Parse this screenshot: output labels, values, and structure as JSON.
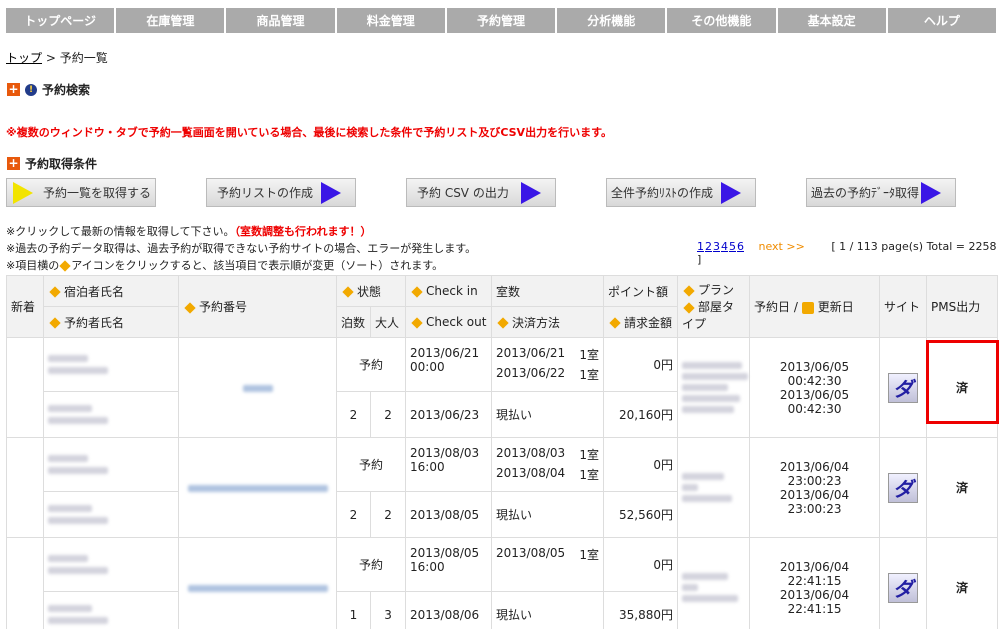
{
  "nav": [
    "トップページ",
    "在庫管理",
    "商品管理",
    "料金管理",
    "予約管理",
    "分析機能",
    "その他機能",
    "基本設定",
    "ヘルプ"
  ],
  "breadcrumb": {
    "home": "トップ",
    "sep": " > ",
    "current": "予約一覧"
  },
  "search_title": "予約検索",
  "warning": "※複数のウィンドウ・タブで予約一覧画面を開いている場合、最後に検索した条件で予約リスト及びCSV出力を行います。",
  "conditions_title": "予約取得条件",
  "buttons": [
    "予約一覧を取得する",
    "予約リストの作成",
    "予約 CSV の出力",
    "全件予約ﾘｽﾄの作成",
    "過去の予約ﾃﾞｰﾀ取得"
  ],
  "notes": {
    "line1": "※クリックして最新の情報を取得して下さい。",
    "line1_red": "（室数調整も行われます！）",
    "line2": "※過去の予約データ取得は、過去予約が取得できない予約サイトの場合、エラーが発生します。",
    "line3a": "※項目横の",
    "line3b": "アイコンをクリックすると、該当項目で表示順が変更（ソート）されます。"
  },
  "pager": {
    "pages": [
      "1",
      "2",
      "3",
      "4",
      "5",
      "6"
    ],
    "next": "next >>",
    "total": "[ 1 / 113 page(s) Total = 2258 ]"
  },
  "headers": {
    "new": "新着",
    "guest": "宿泊者氏名",
    "booker": "予約者氏名",
    "res_no": "予約番号",
    "status": "状態",
    "checkin": "Check in",
    "rooms": "室数",
    "points": "ポイント額",
    "plan": "プラン",
    "roomtype": "部屋タイプ",
    "nights": "泊数",
    "adults": "大人",
    "checkout": "Check out",
    "payment": "決済方法",
    "billing": "請求金額",
    "resdate": "予約日 /",
    "updated": "更新日",
    "site": "サイト",
    "pms": "PMS出力"
  },
  "rows": [
    {
      "status": "予約",
      "checkin": "2013/06/21\n00:00",
      "date1": "2013/06/21",
      "date2": "2013/06/22",
      "room1": "1室",
      "room2": "1室",
      "points": "0円",
      "nights": "2",
      "adults": "2",
      "checkout": "2013/06/23",
      "payment": "現払い",
      "amount": "20,160円",
      "resdate": "2013/06/05 00:42:30",
      "updated": "2013/06/05 00:42:30",
      "site": "ダ",
      "pms": "済"
    },
    {
      "status": "予約",
      "checkin": "2013/08/03\n16:00",
      "date1": "2013/08/03",
      "date2": "2013/08/04",
      "room1": "1室",
      "room2": "1室",
      "points": "0円",
      "nights": "2",
      "adults": "2",
      "checkout": "2013/08/05",
      "payment": "現払い",
      "amount": "52,560円",
      "resdate": "2013/06/04 23:00:23",
      "updated": "2013/06/04 23:00:23",
      "site": "ダ",
      "pms": "済"
    },
    {
      "status": "予約",
      "checkin": "2013/08/05\n16:00",
      "date1": "2013/08/05",
      "date2": "",
      "room1": "1室",
      "room2": "",
      "points": "0円",
      "nights": "1",
      "adults": "3",
      "checkout": "2013/08/06",
      "payment": "現払い",
      "amount": "35,880円",
      "resdate": "2013/06/04 22:41:15",
      "updated": "2013/06/04 22:41:15",
      "site": "ダ",
      "pms": "済"
    }
  ]
}
